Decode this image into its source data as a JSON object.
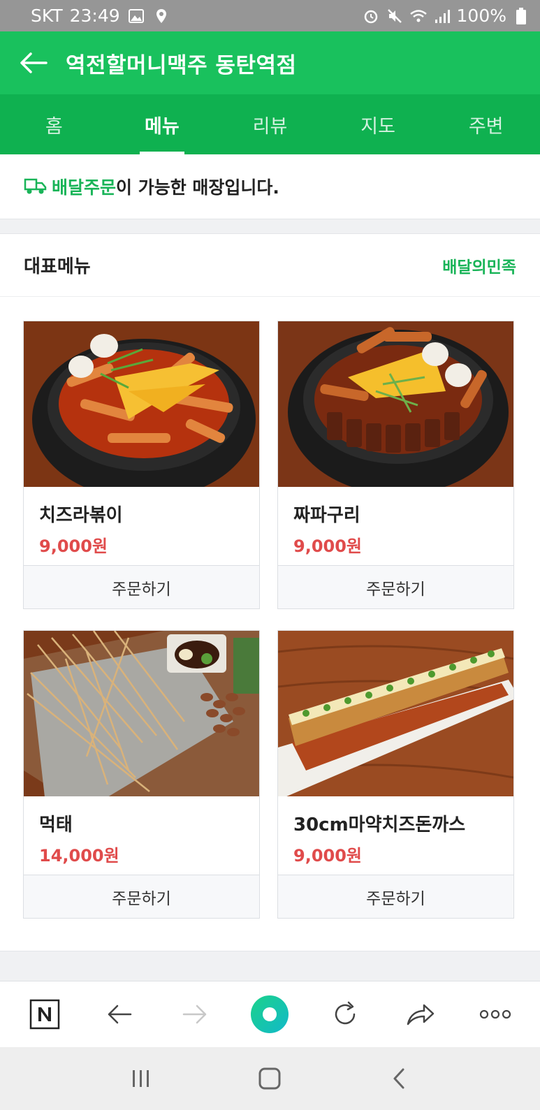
{
  "status_bar": {
    "carrier": "SKT",
    "time": "23:49",
    "battery": "100%"
  },
  "header": {
    "title": "역전할머니맥주 동탄역점"
  },
  "tabs": [
    {
      "label": "홈",
      "active": false
    },
    {
      "label": "메뉴",
      "active": true
    },
    {
      "label": "리뷰",
      "active": false
    },
    {
      "label": "지도",
      "active": false
    },
    {
      "label": "주변",
      "active": false
    }
  ],
  "notice": {
    "highlight": "배달주문",
    "text": "이 가능한 매장입니다."
  },
  "menu_section": {
    "title": "대표메뉴",
    "link": "배달의민족",
    "items": [
      {
        "name": "치즈라볶이",
        "price": "9,000원",
        "order_label": "주문하기"
      },
      {
        "name": "짜파구리",
        "price": "9,000원",
        "order_label": "주문하기"
      },
      {
        "name": "먹태",
        "price": "14,000원",
        "order_label": "주문하기"
      },
      {
        "name": "30cm마약치즈돈까스",
        "price": "9,000원",
        "order_label": "주문하기"
      }
    ]
  },
  "colors": {
    "brand_green": "#19c15d",
    "tab_green": "#0fb150",
    "price_red": "#e04b4b"
  },
  "browser_bar": {
    "icons": [
      "naver-n-icon",
      "back-arrow-icon",
      "forward-arrow-icon",
      "home-circle-icon",
      "refresh-icon",
      "share-icon",
      "more-icon"
    ]
  }
}
